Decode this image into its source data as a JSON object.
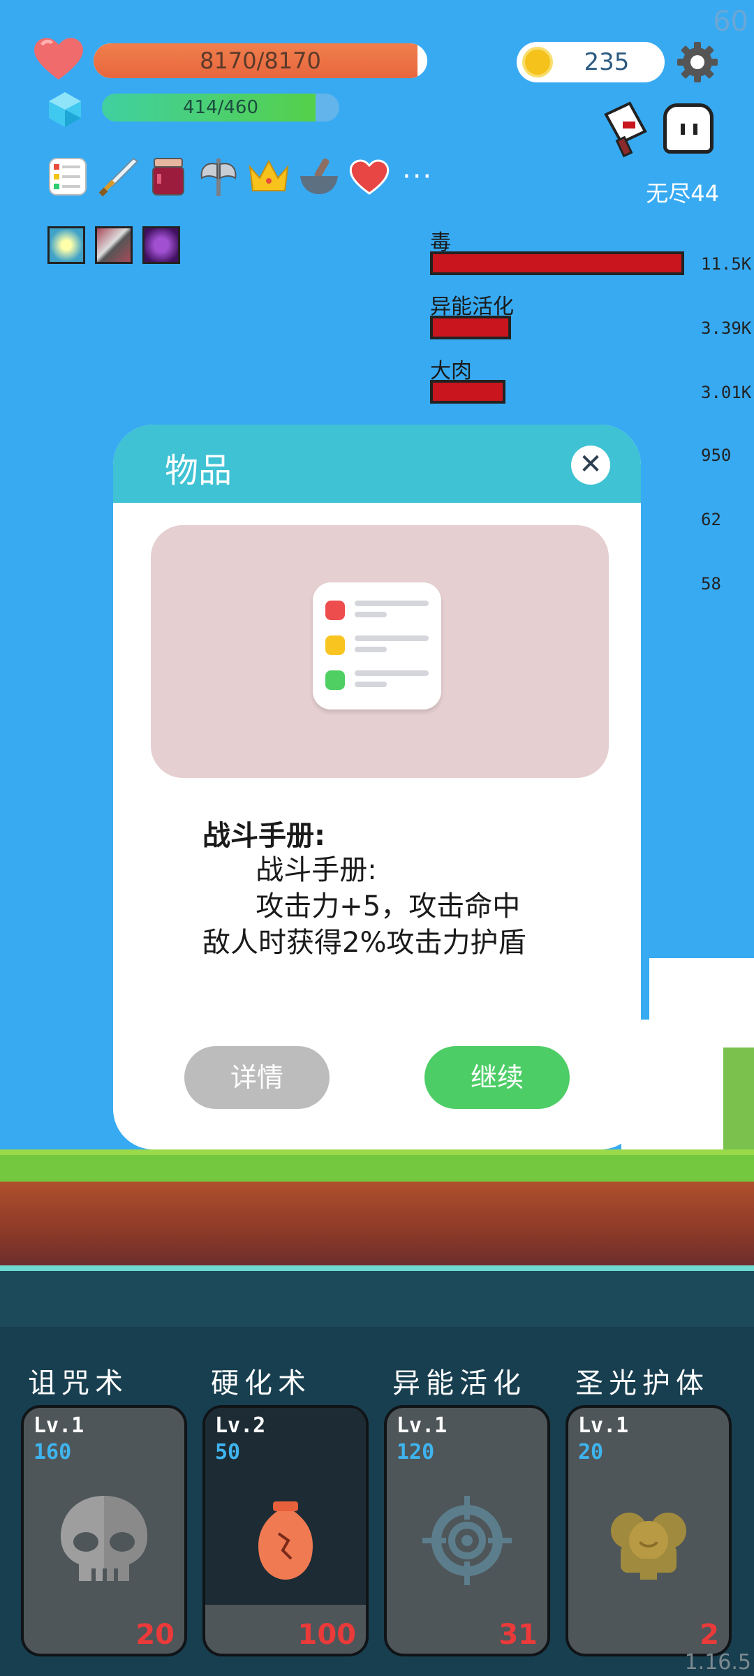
{
  "hud": {
    "fps": "60",
    "hp_text": "8170/8170",
    "hp_fraction": 0.97,
    "mp_text": "414/460",
    "mp_fraction": 0.9,
    "coins": "235",
    "stage": "无尽44",
    "more_items": "···"
  },
  "stats": [
    {
      "label": "毒",
      "value": "11.5K",
      "fraction": 1.0
    },
    {
      "label": "异能活化",
      "value": "3.39K",
      "fraction": 0.3
    },
    {
      "label": "大肉",
      "value": "3.01K",
      "fraction": 0.27
    },
    {
      "label": "",
      "value": "950",
      "fraction": 0
    },
    {
      "label": "",
      "value": "62",
      "fraction": 0
    },
    {
      "label": "",
      "value": "58",
      "fraction": 0
    }
  ],
  "modal": {
    "title": "物品",
    "close": "✕",
    "item_name": "战斗手册:",
    "item_desc": "      战斗手册:\n      攻击力+5，攻击命中\n敌人时获得2%攻击力护盾",
    "detail_btn": "详情",
    "continue_btn": "继续"
  },
  "skills": [
    {
      "name": "诅咒术",
      "level": "Lv.1",
      "cost": "160",
      "count": "20",
      "icon": "skull-icon",
      "cooldown_fraction": 0
    },
    {
      "name": "硬化术",
      "level": "Lv.2",
      "cost": "50",
      "count": "100",
      "icon": "vase-icon",
      "cooldown_fraction": 0.8
    },
    {
      "name": "异能活化",
      "level": "Lv.1",
      "cost": "120",
      "count": "31",
      "icon": "crosshair-icon",
      "cooldown_fraction": 0
    },
    {
      "name": "圣光护体",
      "level": "Lv.1",
      "cost": "20",
      "count": "2",
      "icon": "holy-shield-icon",
      "cooldown_fraction": 0
    }
  ],
  "version": "1.16.5",
  "colors": {
    "sky": "#38aaf2",
    "hp": "#e8663e",
    "modal_header": "#3fc2d3",
    "continue": "#4dcd66",
    "detail": "#bcbcbc",
    "stat_bar": "#c8151e"
  }
}
